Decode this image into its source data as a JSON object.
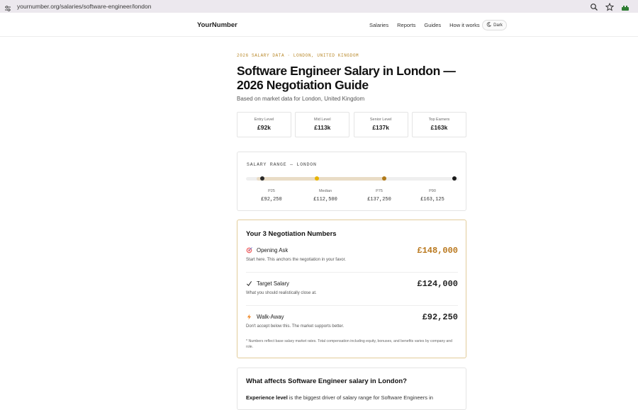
{
  "browser": {
    "url": "yournumber.org/salaries/software-engineer/london"
  },
  "nav": {
    "logo": "YourNumber",
    "links": [
      "Salaries",
      "Reports",
      "Guides",
      "How it works"
    ],
    "theme_toggle": "Dark"
  },
  "hero": {
    "eyebrow": "2026 SALARY DATA · LONDON, UNITED KINGDOM",
    "title": "Software Engineer Salary in London — 2026 Negotiation Guide",
    "subtitle": "Based on market data for London, United Kingdom"
  },
  "levels": [
    {
      "label": "Entry Level",
      "value": "£92k"
    },
    {
      "label": "Mid Level",
      "value": "£113k"
    },
    {
      "label": "Senior Level",
      "value": "£137k"
    },
    {
      "label": "Top Earners",
      "value": "£163k"
    }
  ],
  "salary_range": {
    "title": "SALARY RANGE — LONDON",
    "markers": [
      {
        "label": "P25",
        "value": "£92,250",
        "amount": 92250,
        "color": "#2a2a2a"
      },
      {
        "label": "Median",
        "value": "£112,500",
        "amount": 112500,
        "color": "#e8b400"
      },
      {
        "label": "P75",
        "value": "£137,250",
        "amount": 137250,
        "color": "#b07a1a"
      },
      {
        "label": "P90",
        "value": "£163,125",
        "amount": 163125,
        "color": "#1a1a1a"
      }
    ]
  },
  "negotiation": {
    "heading": "Your 3 Negotiation Numbers",
    "opening": {
      "icon": "target-icon",
      "label": "Opening Ask",
      "desc": "Start here. This anchors the negotiation in your favor.",
      "amount": "£148,000"
    },
    "target": {
      "icon": "check-icon",
      "label": "Target Salary",
      "desc": "What you should realistically close at.",
      "amount": "£124,000"
    },
    "walkaway": {
      "icon": "lightning-icon",
      "label": "Walk-Away",
      "desc": "Don't accept below this. The market supports better.",
      "amount": "£92,250"
    },
    "note": "* Numbers reflect base salary market rates. Total compensation including equity, bonuses, and benefits varies by company and role."
  },
  "affects": {
    "title": "What affects Software Engineer salary in London?",
    "lead_bold": "Experience level",
    "lead_text": " is the biggest driver of salary range for Software Engineers in"
  },
  "colors": {
    "accent_gold": "#b9771c",
    "eyebrow_gold": "#b9892a",
    "card_border_gold": "#e2cc9a"
  }
}
